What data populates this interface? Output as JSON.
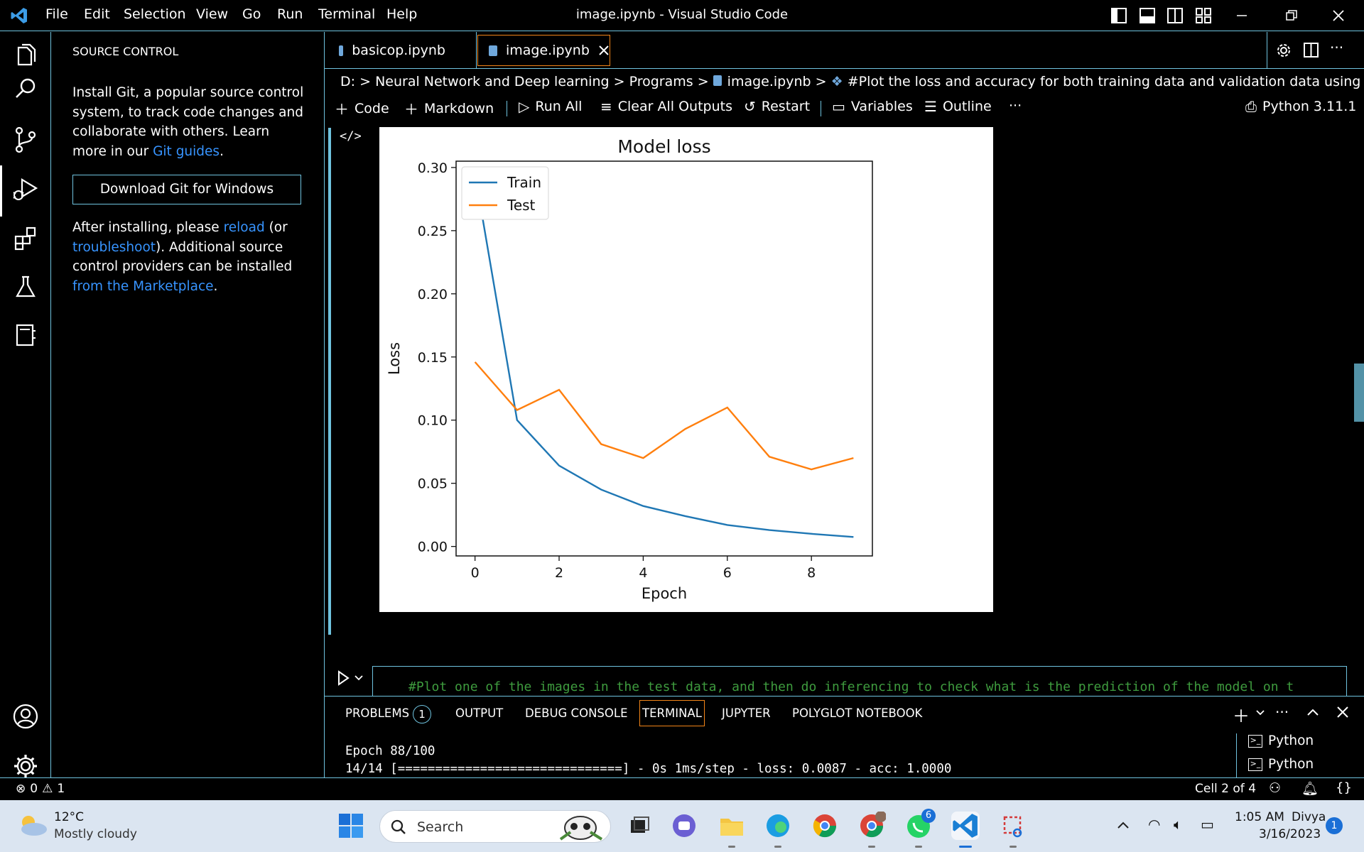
{
  "titlebar": {
    "menus": [
      "File",
      "Edit",
      "Selection",
      "View",
      "Go",
      "Run",
      "Terminal",
      "Help"
    ],
    "title": "image.ipynb - Visual Studio Code"
  },
  "sidebar": {
    "header": "SOURCE CONTROL",
    "intro_pre": "Install Git, a popular source control system, to track code changes and collaborate with others. Learn more in our ",
    "intro_link": "Git guides",
    "intro_post": ".",
    "download_button": "Download Git for Windows",
    "after_pre": "After installing, please ",
    "after_link1": "reload",
    "after_mid1": " (or ",
    "after_link2": "troubleshoot",
    "after_mid2": "). Additional source control providers can be installed ",
    "after_link3": "from the Marketplace",
    "after_post": "."
  },
  "tabs": [
    {
      "label": "basicop.ipynb",
      "active": false
    },
    {
      "label": "image.ipynb",
      "active": true
    }
  ],
  "breadcrumb": {
    "drive": "D:",
    "folder1": "Neural Network and Deep learning",
    "folder2": "Programs",
    "file": "image.ipynb",
    "symbol": "#Plot the loss and accuracy for both training data and validation data using the history ob"
  },
  "toolbar": {
    "code": "Code",
    "markdown": "Markdown",
    "run_all": "Run All",
    "clear_outputs": "Clear All Outputs",
    "restart": "Restart",
    "variables": "Variables",
    "outline": "Outline",
    "more": "···",
    "kernel": "Python 3.11.1"
  },
  "chart_data": {
    "type": "line",
    "title": "Model loss",
    "xlabel": "Epoch",
    "ylabel": "Loss",
    "xlim": [
      -0.45,
      9.45
    ],
    "ylim": [
      -0.0075,
      0.305
    ],
    "xticks": [
      0,
      2,
      4,
      6,
      8
    ],
    "yticks": [
      "0.00",
      "0.05",
      "0.10",
      "0.15",
      "0.20",
      "0.25",
      "0.30"
    ],
    "legend_position": "top-left",
    "x": [
      0,
      1,
      2,
      3,
      4,
      5,
      6,
      7,
      8,
      9
    ],
    "series": [
      {
        "name": "Train",
        "color": "#1f77b4",
        "values": [
          0.295,
          0.1,
          0.064,
          0.045,
          0.032,
          0.024,
          0.017,
          0.013,
          0.01,
          0.0075
        ]
      },
      {
        "name": "Test",
        "color": "#ff7f0e",
        "values": [
          0.146,
          0.108,
          0.124,
          0.081,
          0.07,
          0.093,
          0.11,
          0.071,
          0.061,
          0.07
        ]
      }
    ]
  },
  "next_cell_code": "#Plot one of the images in the test data, and then do inferencing to check what is the prediction of the model on t",
  "panel": {
    "tabs": [
      "PROBLEMS",
      "OUTPUT",
      "DEBUG CONSOLE",
      "TERMINAL",
      "JUPYTER",
      "POLYGLOT NOTEBOOK"
    ],
    "problems_count": "1",
    "terminal_line1": "Epoch 88/100",
    "terminal_line2": "14/14 [==============================] - 0s 1ms/step - loss: 0.0087 - acc: 1.0000",
    "terminals": [
      "Python",
      "Python"
    ]
  },
  "statusbar": {
    "errors": "0",
    "warnings": "1",
    "cell": "Cell 2 of 4"
  },
  "taskbar": {
    "temp": "12°C",
    "weather": "Mostly cloudy",
    "search_placeholder": "Search",
    "time": "1:05 AM",
    "user": "Divya",
    "date": "3/16/2023",
    "notif_count": "1",
    "whatsapp_badge": "6"
  }
}
